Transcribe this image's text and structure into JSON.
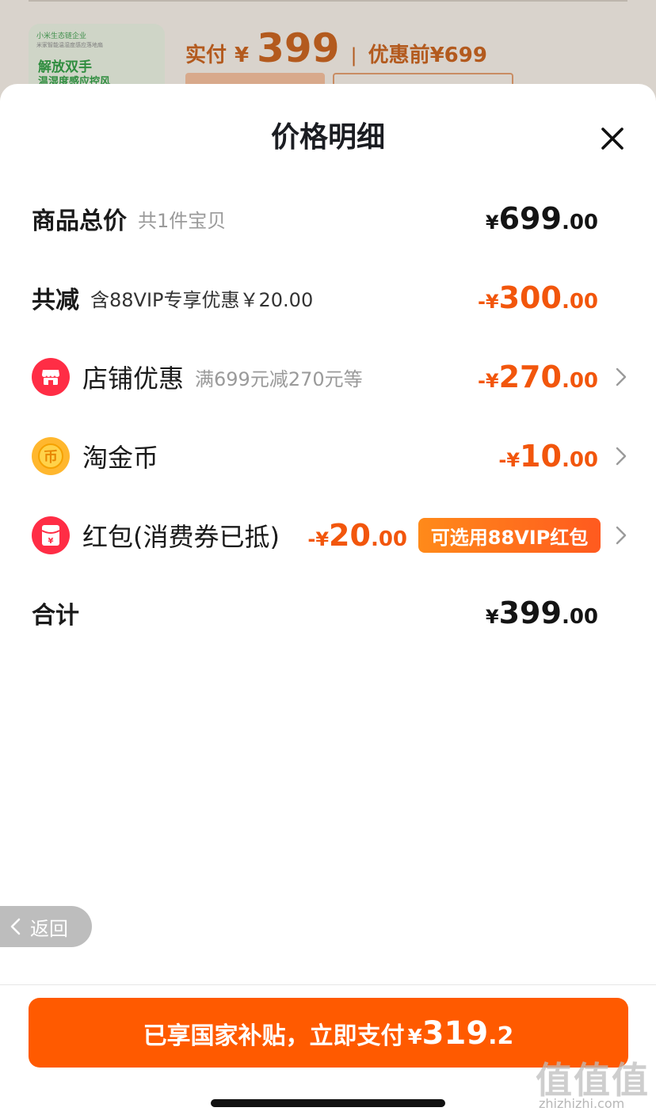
{
  "background_card": {
    "thumb_brand": "小米生态链企业",
    "thumb_subtitle": "米家智能温湿度感应落地扇",
    "thumb_line1": "解放双手",
    "thumb_line2": "温湿度感应控风",
    "paid_label": "实付",
    "paid_currency": "¥",
    "paid_amount": "399",
    "separator": "|",
    "before_discount": "优惠前¥699"
  },
  "sheet": {
    "title": "价格明细",
    "close_icon": "close-icon"
  },
  "rows": {
    "total": {
      "label": "商品总价",
      "note": "共1件宝贝",
      "currency": "¥",
      "integer": "699",
      "decimal": ".00"
    },
    "reduce": {
      "label": "共减",
      "note": "含88VIP专享优惠￥20.00",
      "currency": "-¥",
      "integer": "300",
      "decimal": ".00"
    },
    "shop": {
      "icon": "store-icon",
      "label": "店铺优惠",
      "note": "满699元减270元等",
      "currency": "-¥",
      "integer": "270",
      "decimal": ".00"
    },
    "coin": {
      "icon": "coin-icon",
      "label": "淘金币",
      "currency": "-¥",
      "integer": "10",
      "decimal": ".00"
    },
    "redpacket": {
      "icon": "red-packet-icon",
      "label": "红包(消费券已抵)",
      "currency": "-¥",
      "integer": "20",
      "decimal": ".00",
      "badge": "可选用88VIP红包"
    },
    "sum": {
      "label": "合计",
      "currency": "¥",
      "integer": "399",
      "decimal": ".00"
    }
  },
  "back_button": {
    "label": "返回",
    "icon": "chevron-left-icon"
  },
  "pay_button": {
    "text": "已享国家补贴，立即支付",
    "currency": "¥",
    "integer": "319",
    "decimal": ".2"
  },
  "watermark": {
    "mark": "值值值",
    "site": "zhizhizhi.com"
  },
  "colors": {
    "accent": "#ff5a00",
    "discount_text": "#f2560c",
    "icon_red": "#ff2d45",
    "icon_gold": "#ffb72e"
  }
}
